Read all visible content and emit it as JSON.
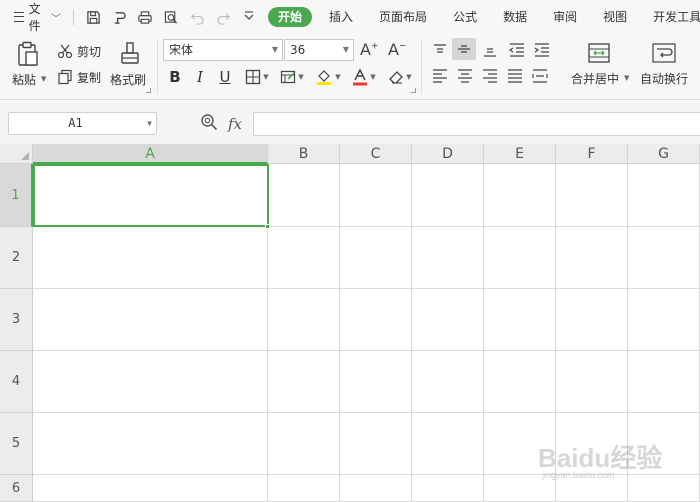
{
  "menubar": {
    "file_label": "文件",
    "tabs": [
      {
        "label": "开始",
        "active": true
      },
      {
        "label": "插入"
      },
      {
        "label": "页面布局"
      },
      {
        "label": "公式"
      },
      {
        "label": "数据"
      },
      {
        "label": "审阅"
      },
      {
        "label": "视图"
      },
      {
        "label": "开发工具"
      }
    ],
    "quick_access_icons": [
      "save-icon",
      "print-format-icon",
      "print-icon",
      "print-preview-icon",
      "undo-icon",
      "redo-icon",
      "customize-icon"
    ]
  },
  "ribbon": {
    "paste_label": "粘贴",
    "cut_label": "剪切",
    "copy_label": "复制",
    "format_painter_label": "格式刷",
    "font_name": "宋体",
    "font_size": "36",
    "merge_center_label": "合并居中",
    "wrap_text_label": "自动换行",
    "font_color": "#e53935",
    "highlight_color": "#ffe600"
  },
  "formula_bar": {
    "name_box": "A1",
    "fx_label": "fx",
    "formula": ""
  },
  "sheet": {
    "columns": [
      "A",
      "B",
      "C",
      "D",
      "E",
      "F",
      "G"
    ],
    "rows": [
      "1",
      "2",
      "3",
      "4",
      "5",
      "6"
    ],
    "selected_cell": "A1",
    "accent_color": "#4aa84f"
  },
  "watermark": {
    "brand": "Baidu经验",
    "sub": "jingyan.baidu.com"
  }
}
